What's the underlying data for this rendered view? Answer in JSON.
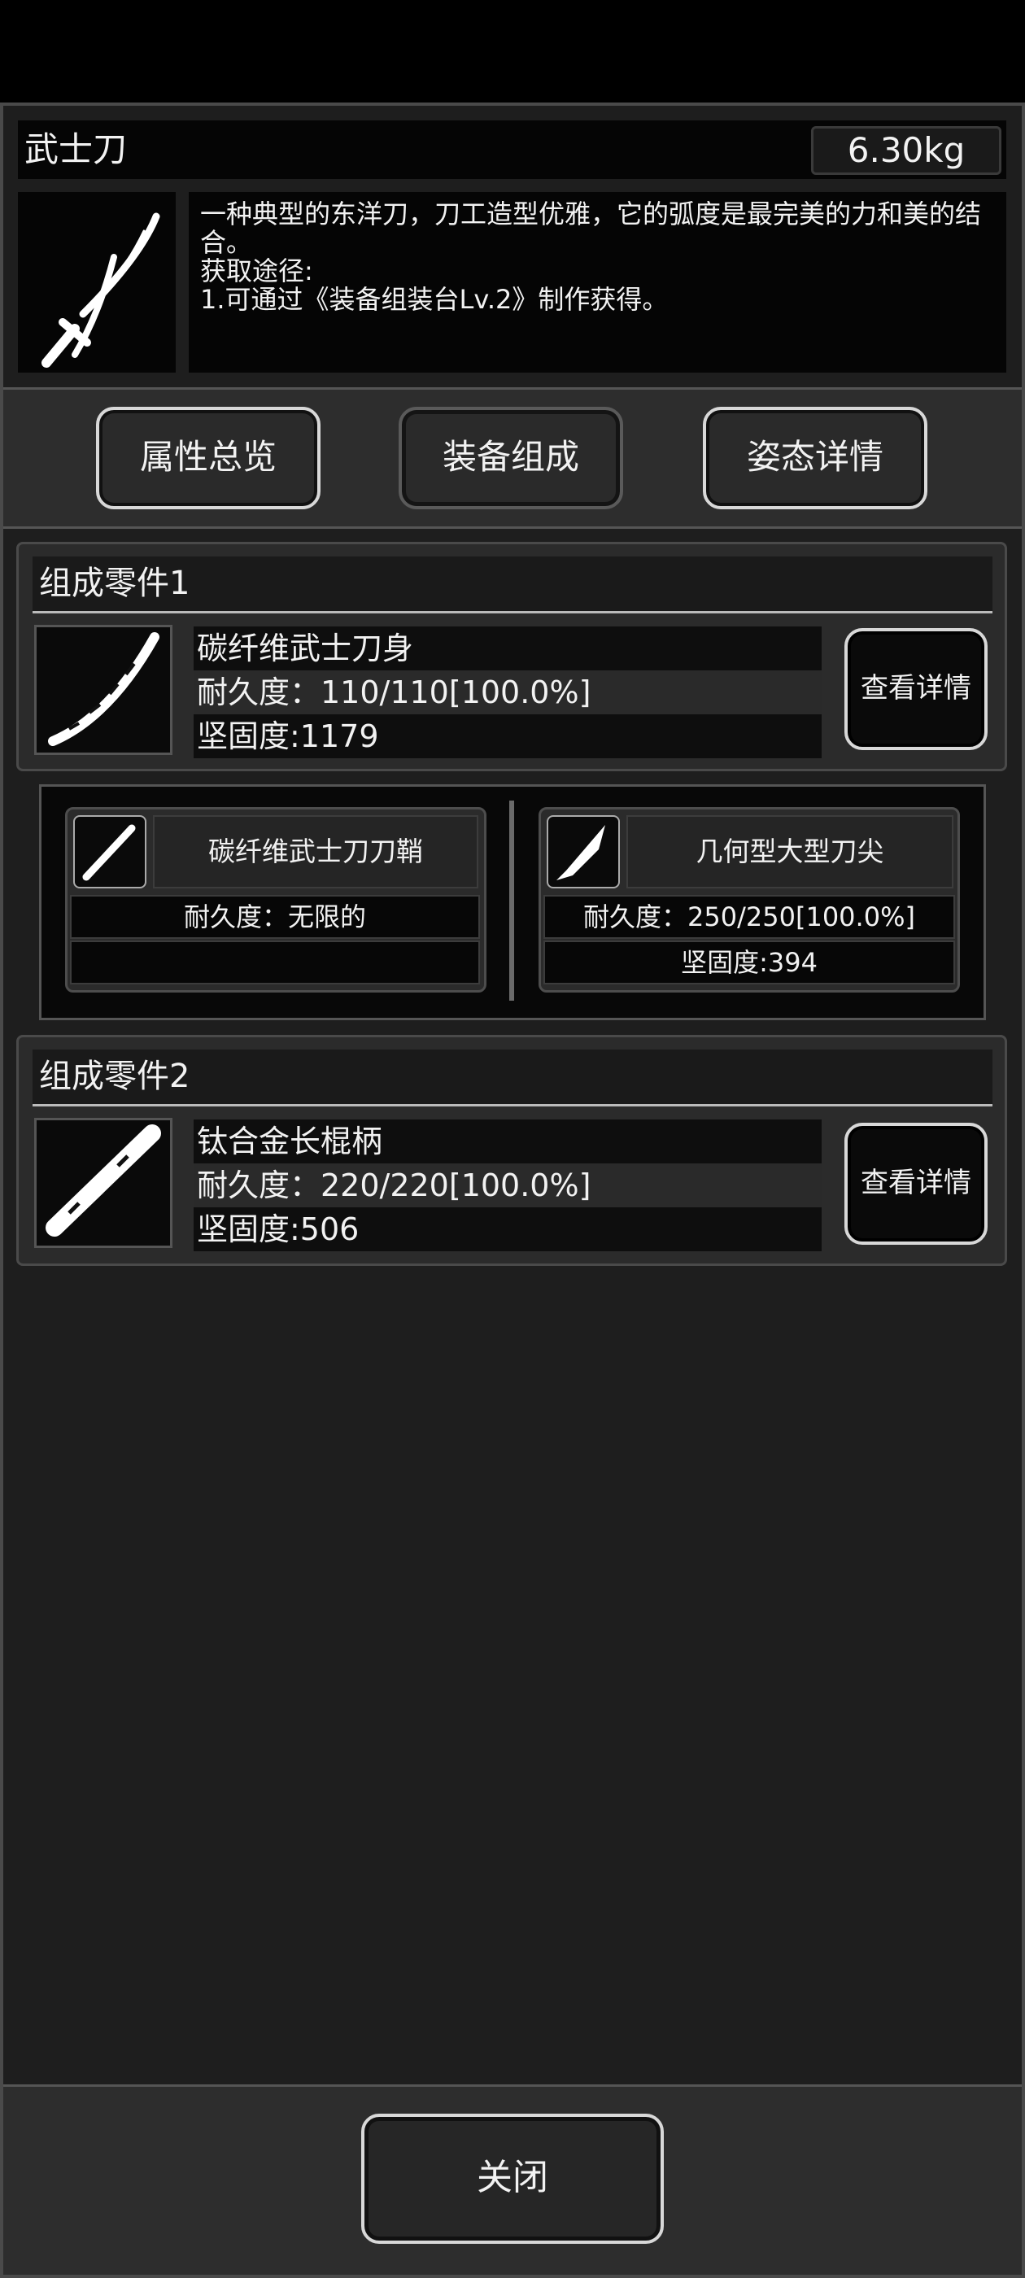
{
  "item": {
    "name": "武士刀",
    "weight": "6.30kg",
    "icon": "katana-icon",
    "description": "一种典型的东洋刀，刀工造型优雅，它的弧度是最完美的力和美的结合。\n获取途径:\n1.可通过《装备组装台Lv.2》制作获得。"
  },
  "tabs": [
    {
      "label": "属性总览"
    },
    {
      "label": "装备组成"
    },
    {
      "label": "姿态详情"
    }
  ],
  "active_tab": "装备组成",
  "components": [
    {
      "header": "组成零件1",
      "name": "碳纤维武士刀身",
      "durability": "耐久度：110/110[100.0%]",
      "hardness": "坚固度:1179",
      "icon": "blade-icon",
      "button": "查看详情",
      "sub_parts": [
        {
          "name": "碳纤维武士刀刀鞘",
          "durability": "耐久度：无限的",
          "hardness": "",
          "icon": "scabbard-icon"
        },
        {
          "name": "几何型大型刀尖",
          "durability": "耐久度：250/250[100.0%]",
          "hardness": "坚固度:394",
          "icon": "blade-tip-icon"
        }
      ]
    },
    {
      "header": "组成零件2",
      "name": "钛合金长棍柄",
      "durability": "耐久度：220/220[100.0%]",
      "hardness": "坚固度:506",
      "icon": "handle-icon",
      "button": "查看详情"
    }
  ],
  "close_label": "关闭",
  "colors": {
    "background": "#1e1e1e",
    "panel": "#2b2b2b",
    "border_light": "#d8d8d8"
  }
}
